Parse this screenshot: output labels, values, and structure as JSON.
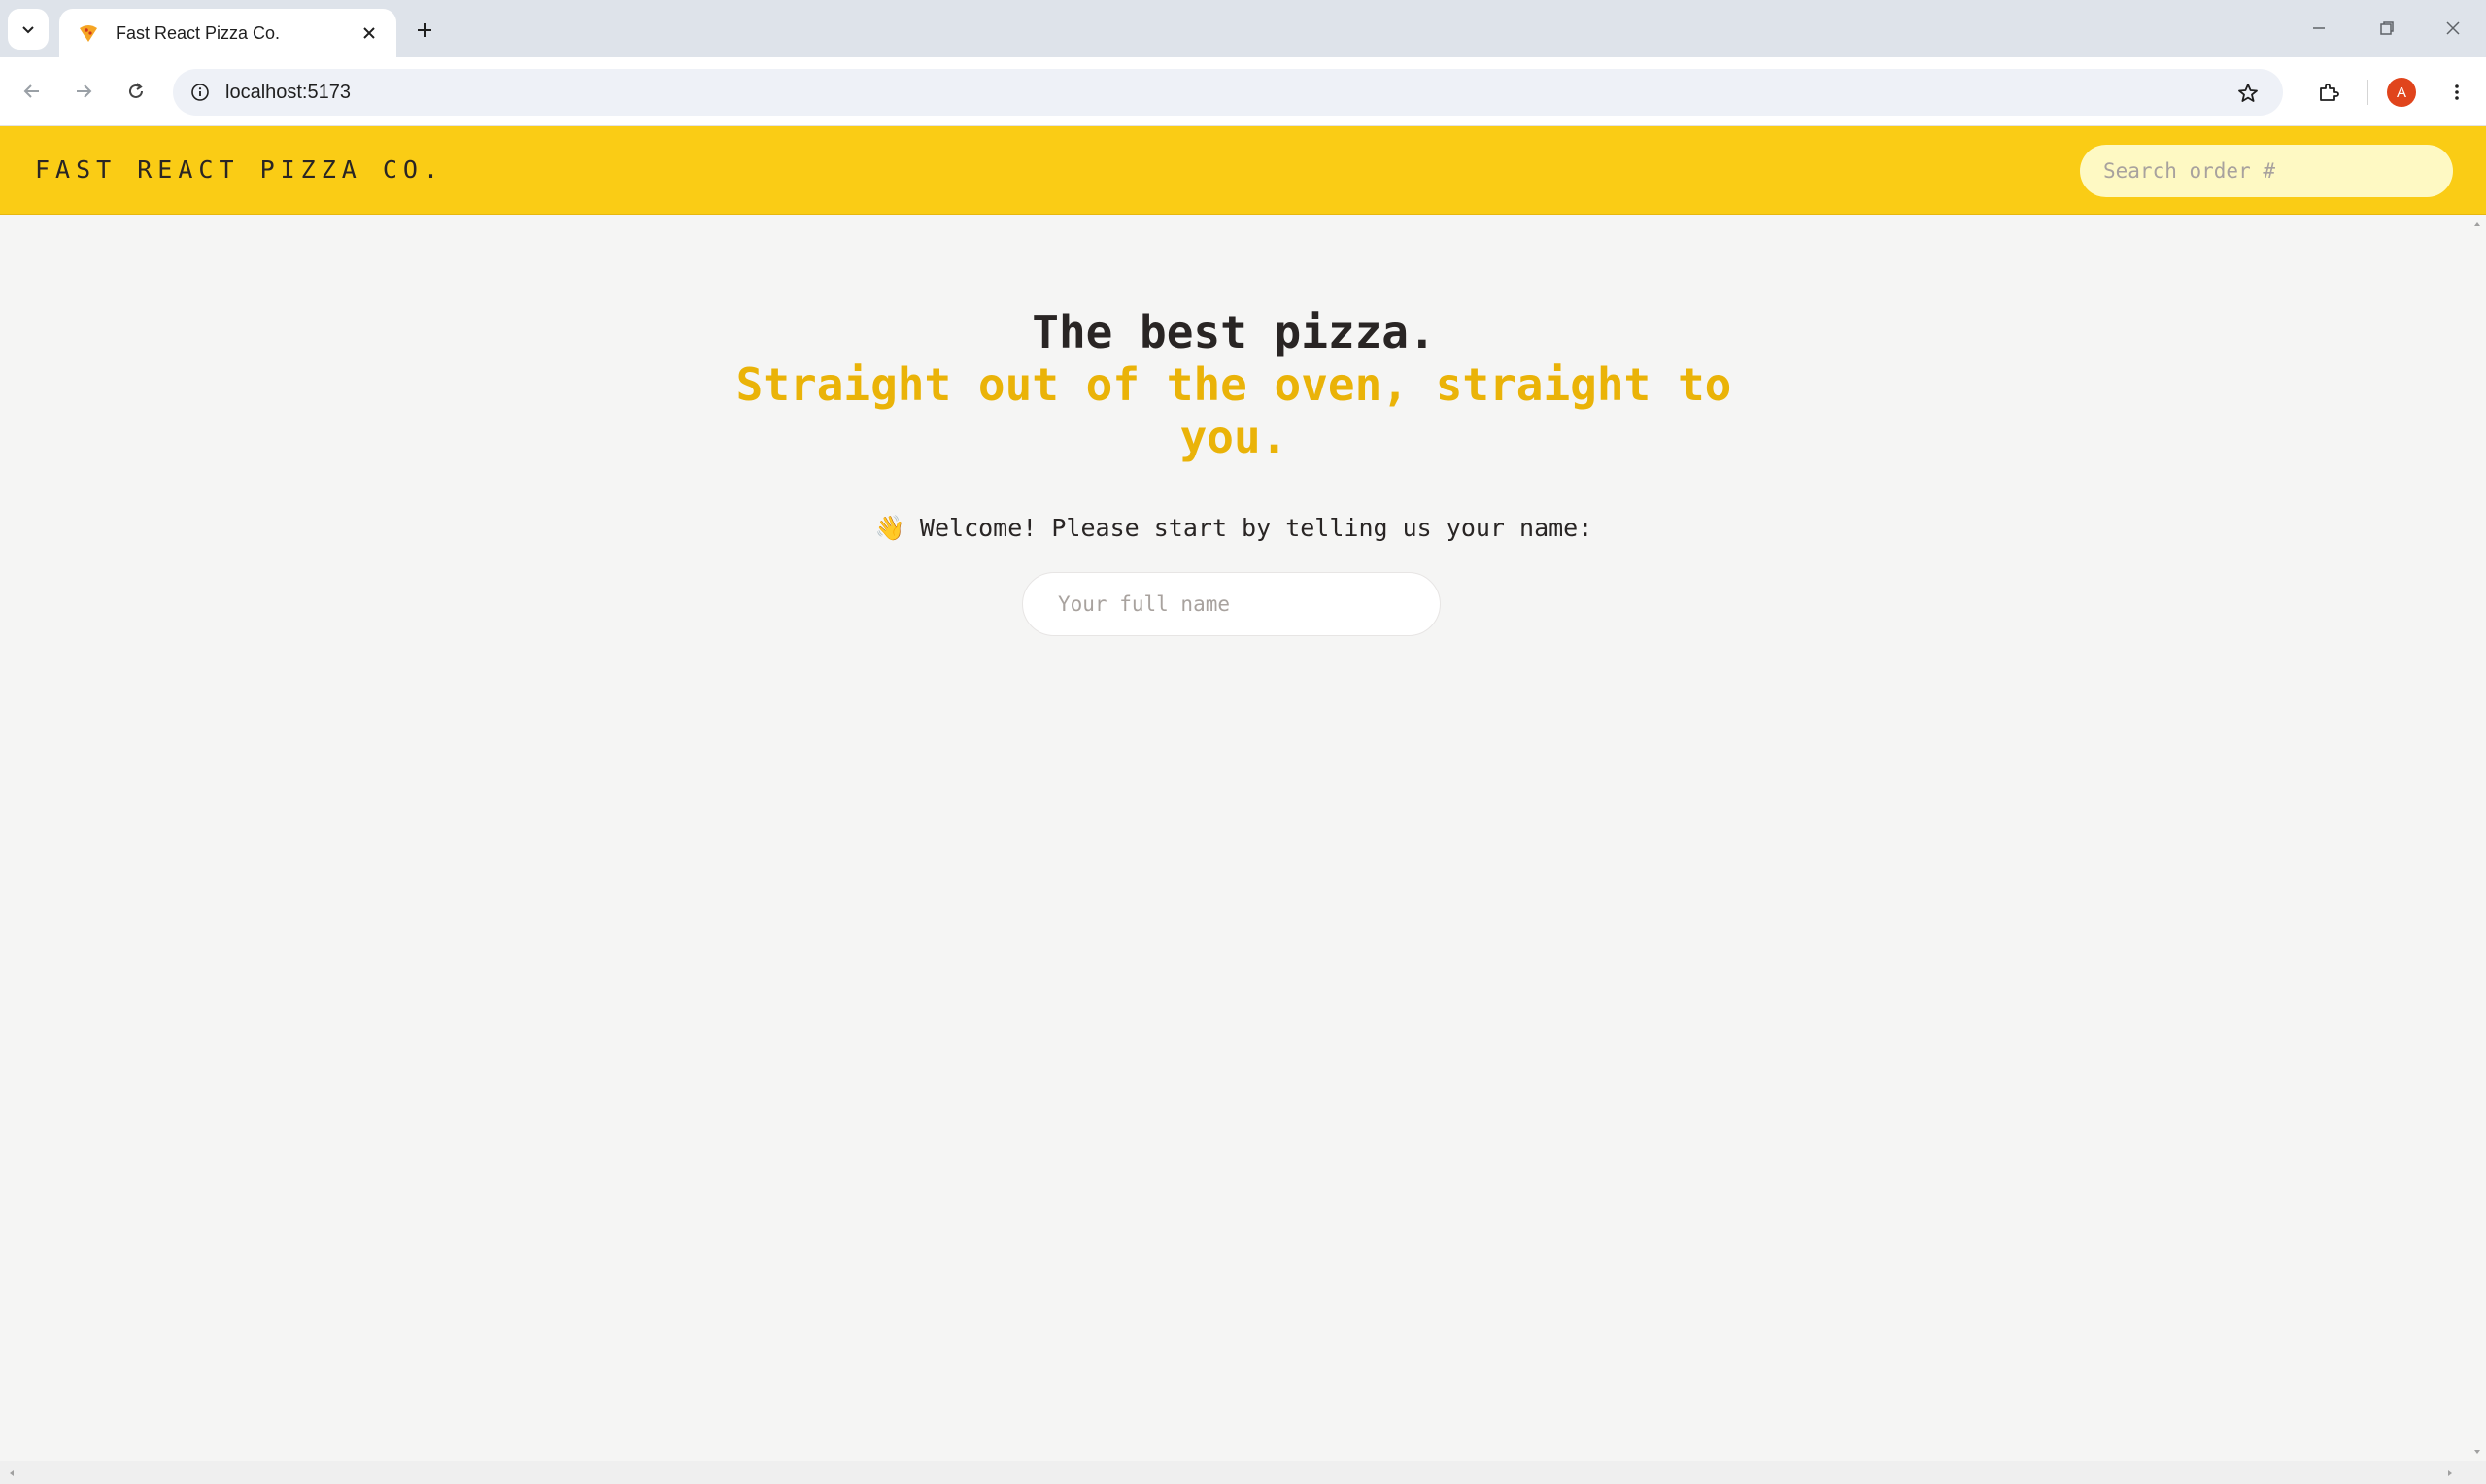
{
  "browser": {
    "tab_title": "Fast React Pizza Co.",
    "url": "localhost:5173",
    "profile_initial": "A"
  },
  "header": {
    "brand": "FAST REACT PIZZA CO.",
    "search_placeholder": "Search order #"
  },
  "home": {
    "headline": "The best pizza.",
    "subheadline_line1": "Straight out of the oven, straight to",
    "subheadline_line2": "you.",
    "welcome_emoji": "👋",
    "welcome_text": "Welcome! Please start by telling us your name:",
    "name_placeholder": "Your full name"
  },
  "colors": {
    "header_bg": "#facc15",
    "accent_text": "#eab308",
    "page_bg": "#f5f5f4",
    "text": "#292524"
  }
}
